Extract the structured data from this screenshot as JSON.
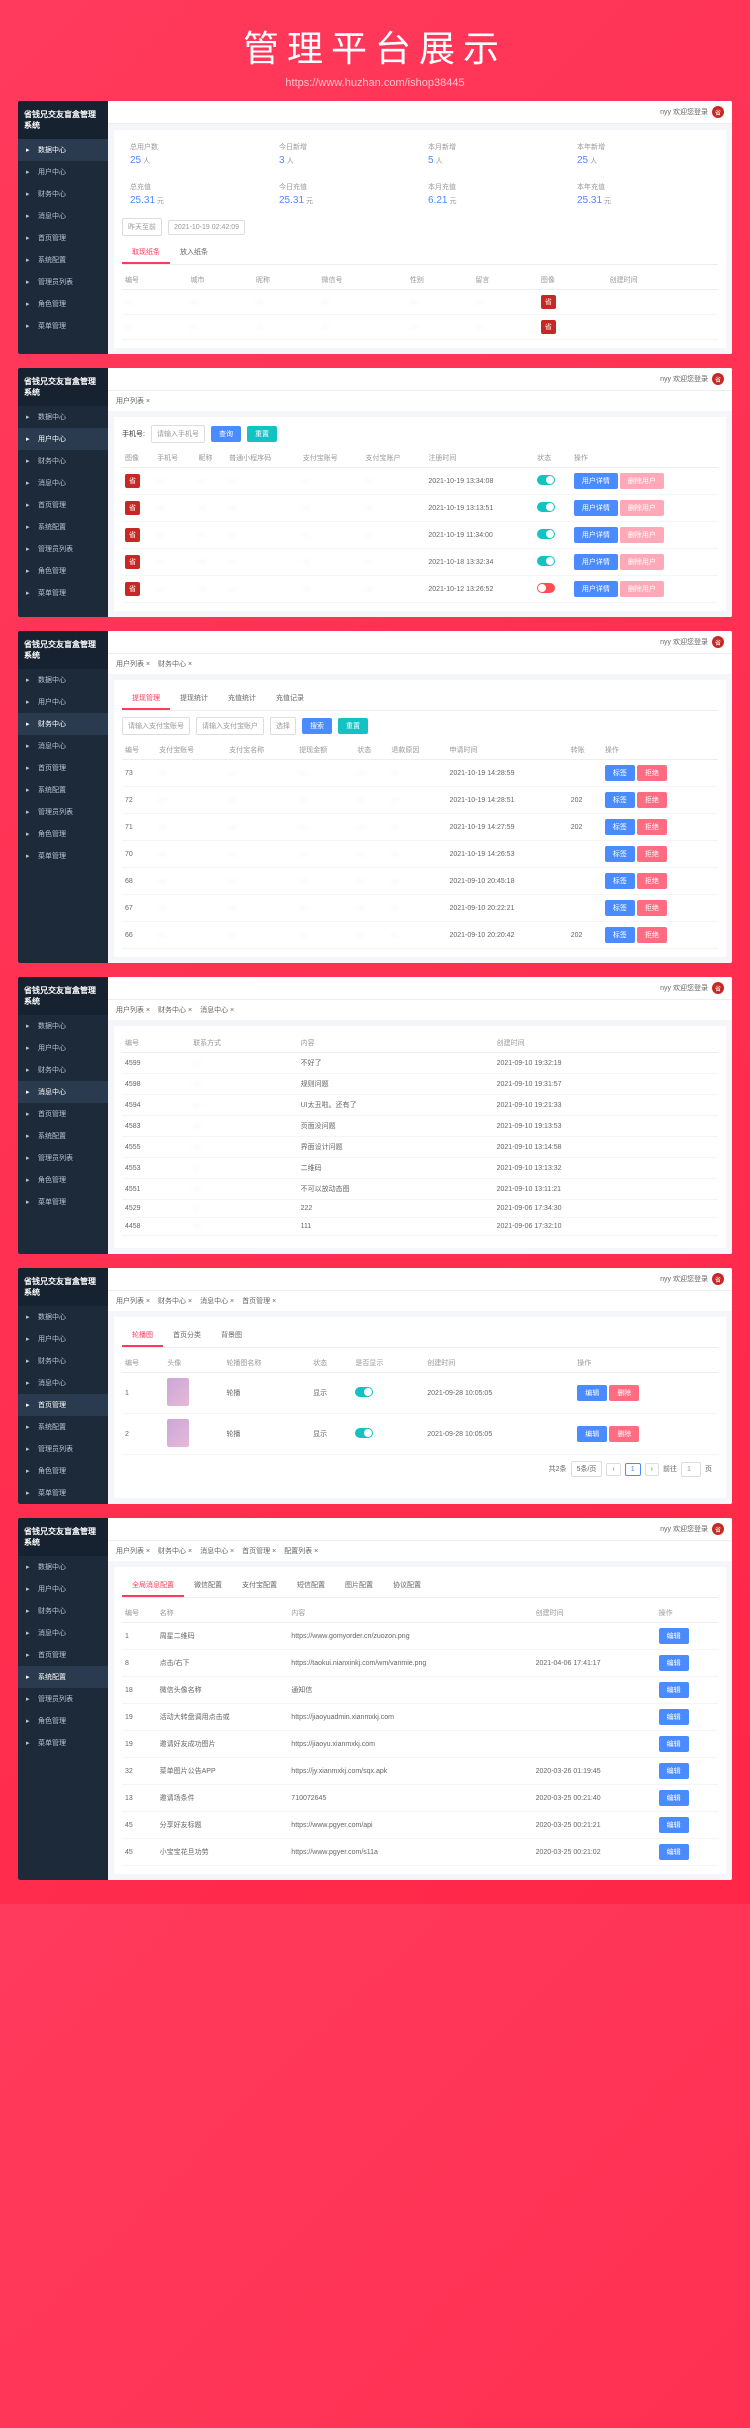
{
  "page_title": "管理平台展示",
  "watermark": "https://www.huzhan.com/ishop38445",
  "system_name": "省钱兄交友盲盒管理系统",
  "topbar": {
    "user_label": "nyy 欢迎您登录",
    "avatar_text": "省"
  },
  "sidebar": {
    "items": [
      {
        "label": "数据中心",
        "icon": "chart-icon"
      },
      {
        "label": "用户中心",
        "icon": "user-icon"
      },
      {
        "label": "财务中心",
        "icon": "wallet-icon"
      },
      {
        "label": "消息中心",
        "icon": "message-icon"
      },
      {
        "label": "首页管理",
        "icon": "home-icon"
      },
      {
        "label": "系统配置",
        "icon": "gear-icon"
      },
      {
        "label": "管理员列表",
        "icon": "admin-icon"
      },
      {
        "label": "角色管理",
        "icon": "role-icon"
      },
      {
        "label": "菜单管理",
        "icon": "menu-icon"
      }
    ]
  },
  "panel1": {
    "stats_row1": [
      {
        "label": "总用户数",
        "value": "25",
        "unit": "人"
      },
      {
        "label": "今日新增",
        "value": "3",
        "unit": "人"
      },
      {
        "label": "本月新增",
        "value": "5",
        "unit": "人"
      },
      {
        "label": "本年新增",
        "value": "25",
        "unit": "人"
      }
    ],
    "stats_row2": [
      {
        "label": "总充值",
        "value": "25.31",
        "unit": "元"
      },
      {
        "label": "今日充值",
        "value": "25.31",
        "unit": "元"
      },
      {
        "label": "本月充值",
        "value": "6.21",
        "unit": "元"
      },
      {
        "label": "本年充值",
        "value": "25.31",
        "unit": "元"
      }
    ],
    "date_btn1": "昨天至前",
    "date_value": "2021-10-19 02:42:09",
    "tabs": [
      {
        "label": "取现纸条"
      },
      {
        "label": "放入纸条"
      }
    ],
    "headers": [
      "编号",
      "城市",
      "昵称",
      "微信号",
      "性别",
      "留言",
      "图像",
      "创建时间"
    ],
    "badge": "省"
  },
  "panel2": {
    "breadcrumb": [
      "用户列表 ×"
    ],
    "search_label": "手机号:",
    "search_placeholder": "请输入手机号",
    "btn_search": "查询",
    "btn_reset": "重置",
    "headers": [
      "图像",
      "手机号",
      "昵称",
      "普通小程序码",
      "支付宝账号",
      "支付宝账户",
      "注册时间",
      "状态",
      "操作"
    ],
    "rows": [
      {
        "time": "2021-10-19 13:34:08",
        "toggle": "on"
      },
      {
        "time": "2021-10-19 13:13:51",
        "toggle": "on"
      },
      {
        "time": "2021-10-19 11:34:00",
        "toggle": "on"
      },
      {
        "time": "2021-10-18 13:32:34",
        "toggle": "on"
      },
      {
        "time": "2021-10-12 13:26:52",
        "toggle": "off"
      }
    ],
    "btn_detail": "用户详情",
    "btn_delete": "删除用户"
  },
  "panel3": {
    "breadcrumb": [
      "用户列表 ×",
      "财务中心 ×"
    ],
    "tabs": [
      {
        "label": "提现管理",
        "active": true
      },
      {
        "label": "提现统计"
      },
      {
        "label": "充值统计"
      },
      {
        "label": "充值记录"
      }
    ],
    "inputs": [
      "请输入支付宝账号",
      "请输入支付宝账户",
      "选择"
    ],
    "btn_search": "搜索",
    "btn_reset": "重置",
    "headers": [
      "编号",
      "支付宝账号",
      "支付宝名称",
      "提现金额",
      "状态",
      "退款原因",
      "申请时间",
      "转账",
      "操作"
    ],
    "rows": [
      {
        "id": "73",
        "time": "2021-10-19 14:28:59"
      },
      {
        "id": "72",
        "time": "2021-10-19 14:28:51",
        "note": "202"
      },
      {
        "id": "71",
        "time": "2021-10-19 14:27:59",
        "note": "202"
      },
      {
        "id": "70",
        "time": "2021-10-19 14:26:53"
      },
      {
        "id": "68",
        "time": "2021-09-10 20:45:18"
      },
      {
        "id": "67",
        "time": "2021-09-10 20:22:21"
      },
      {
        "id": "66",
        "time": "2021-09-10 20:20:42",
        "note": "202"
      }
    ],
    "btn_tag1": "标签",
    "btn_tag2": "拒绝"
  },
  "panel4": {
    "breadcrumb": [
      "用户列表 ×",
      "财务中心 ×",
      "消息中心 ×"
    ],
    "headers": [
      "编号",
      "联系方式",
      "内容",
      "创建时间"
    ],
    "rows": [
      {
        "id": "4599",
        "content": "不好了",
        "time": "2021-09-10 19:32:19"
      },
      {
        "id": "4598",
        "content": "规则问题",
        "time": "2021-09-10 19:31:57"
      },
      {
        "id": "4594",
        "content": "UI太丑啦。还有了",
        "time": "2021-09-10 19:21:33"
      },
      {
        "id": "4583",
        "content": "页面没问题",
        "time": "2021-09-10 19:13:53"
      },
      {
        "id": "4555",
        "content": "界面设计问题",
        "time": "2021-09-10 13:14:58"
      },
      {
        "id": "4553",
        "content": "二维码",
        "time": "2021-09-10 13:13:32"
      },
      {
        "id": "4551",
        "content": "不可以放动态图",
        "time": "2021-09-10 13:11:21"
      },
      {
        "id": "4529",
        "content": "222",
        "time": "2021-09-06 17:34:30"
      },
      {
        "id": "4458",
        "content": "111",
        "time": "2021-09-06 17:32:10"
      }
    ]
  },
  "panel5": {
    "breadcrumb": [
      "用户列表 ×",
      "财务中心 ×",
      "消息中心 ×",
      "首页管理 ×"
    ],
    "tabs": [
      {
        "label": "轮播图",
        "active": true
      },
      {
        "label": "首页分类"
      },
      {
        "label": "背景图"
      }
    ],
    "headers": [
      "编号",
      "头像",
      "轮播图名称",
      "状态",
      "是否显示",
      "创建时间",
      "操作"
    ],
    "rows": [
      {
        "id": "1",
        "name": "轮播",
        "status": "显示",
        "time": "2021-09-28 10:05:05"
      },
      {
        "id": "2",
        "name": "轮播",
        "status": "显示",
        "time": "2021-09-28 10:05:05"
      }
    ],
    "btn_edit": "编辑",
    "btn_del": "删除",
    "pagination": {
      "total": "共2条",
      "perpage": "5条/页",
      "page": "1",
      "jump": "前往",
      "unit": "页"
    }
  },
  "panel6": {
    "breadcrumb": [
      "用户列表 ×",
      "财务中心 ×",
      "消息中心 ×",
      "首页管理 ×",
      "配置列表 ×"
    ],
    "tabs": [
      {
        "label": "全局消息配置",
        "active": true
      },
      {
        "label": "微信配置"
      },
      {
        "label": "支付宝配置"
      },
      {
        "label": "短信配置"
      },
      {
        "label": "图片配置"
      },
      {
        "label": "协议配置"
      }
    ],
    "headers": [
      "编号",
      "名称",
      "内容",
      "创建时间",
      "操作"
    ],
    "rows": [
      {
        "id": "1",
        "name": "周星二维码",
        "content": "https://www.gomyorder.cn/zuozon.png",
        "time": ""
      },
      {
        "id": "8",
        "name": "点击/右下",
        "content": "https://taokui.nianxinkj.com/wm/vanmie.png",
        "time": "2021-04-06 17:41:17"
      },
      {
        "id": "18",
        "name": "微信头像名称",
        "content": "通知信",
        "time": ""
      },
      {
        "id": "19",
        "name": "活动大转盘调用点击或",
        "content": "https://jiaoyuadmin.xianmxkj.com",
        "time": ""
      },
      {
        "id": "19",
        "name": "邀请好友成功图片",
        "content": "https://jiaoyu.xianmxkj.com",
        "time": ""
      },
      {
        "id": "32",
        "name": "菜单图片公告APP",
        "content": "https://jy.xianmxkj.com/sqx.apk",
        "time": "2020-03-26 01:19:45"
      },
      {
        "id": "13",
        "name": "邀请场条件",
        "content": "710072645",
        "time": "2020-03-25 00:21:40"
      },
      {
        "id": "45",
        "name": "分享好友标题",
        "content": "https://www.pgyer.com/api",
        "time": "2020-03-25 00:21:21"
      },
      {
        "id": "45",
        "name": "小宝宝花旦功劳",
        "content": "https://www.pgyer.com/s11a",
        "time": "2020-03-25 00:21:02"
      }
    ],
    "btn_edit": "编辑"
  }
}
